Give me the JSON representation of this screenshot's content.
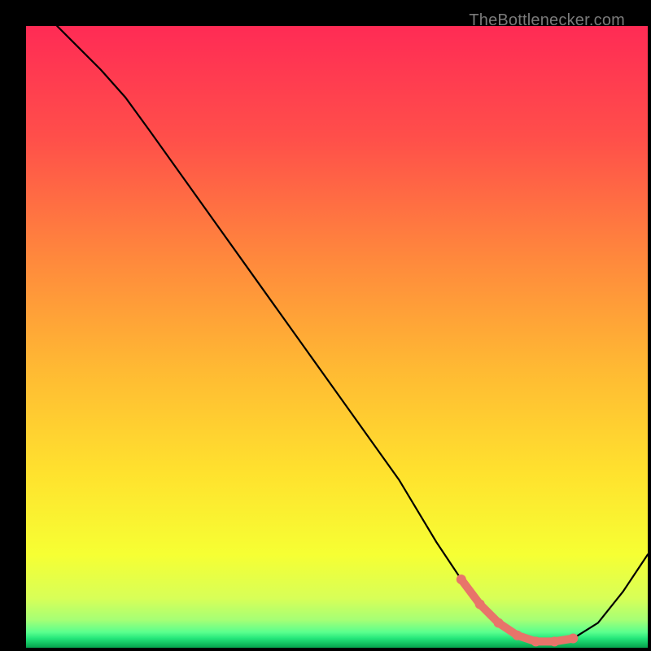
{
  "watermark": "TheBottlenecker.com",
  "colors": {
    "frame": "#000000",
    "curve": "#000000",
    "marker": "#e8746a"
  },
  "gradient_stops": [
    {
      "offset": 0.0,
      "color": "#ff2b55"
    },
    {
      "offset": 0.18,
      "color": "#ff4f4a"
    },
    {
      "offset": 0.38,
      "color": "#ff8a3c"
    },
    {
      "offset": 0.55,
      "color": "#ffb933"
    },
    {
      "offset": 0.72,
      "color": "#ffe22e"
    },
    {
      "offset": 0.85,
      "color": "#f6ff33"
    },
    {
      "offset": 0.92,
      "color": "#d8ff57"
    },
    {
      "offset": 0.955,
      "color": "#a6ff75"
    },
    {
      "offset": 0.975,
      "color": "#5aff8e"
    },
    {
      "offset": 0.985,
      "color": "#24e67a"
    },
    {
      "offset": 0.995,
      "color": "#0fb95b"
    },
    {
      "offset": 1.0,
      "color": "#07a24e"
    }
  ],
  "chart_data": {
    "type": "line",
    "title": "",
    "xlabel": "",
    "ylabel": "",
    "xlim": [
      0,
      100
    ],
    "ylim": [
      0,
      100
    ],
    "series": [
      {
        "name": "bottleneck-curve",
        "x": [
          5,
          8,
          12,
          16,
          20,
          25,
          30,
          35,
          40,
          45,
          50,
          55,
          60,
          63,
          66,
          70,
          73,
          76,
          79,
          82,
          85,
          88,
          92,
          96,
          100
        ],
        "y": [
          100,
          97,
          93,
          88.5,
          83,
          76,
          69,
          62,
          55,
          48,
          41,
          34,
          27,
          22,
          17,
          11,
          7,
          4,
          2,
          1,
          1,
          1.5,
          4,
          9,
          15
        ]
      }
    ],
    "highlight_segment": {
      "name": "optimal-range-markers",
      "x": [
        70,
        73,
        76,
        79,
        82,
        85,
        88
      ],
      "y": [
        11,
        7,
        4,
        2,
        1,
        1,
        1.5
      ]
    }
  }
}
